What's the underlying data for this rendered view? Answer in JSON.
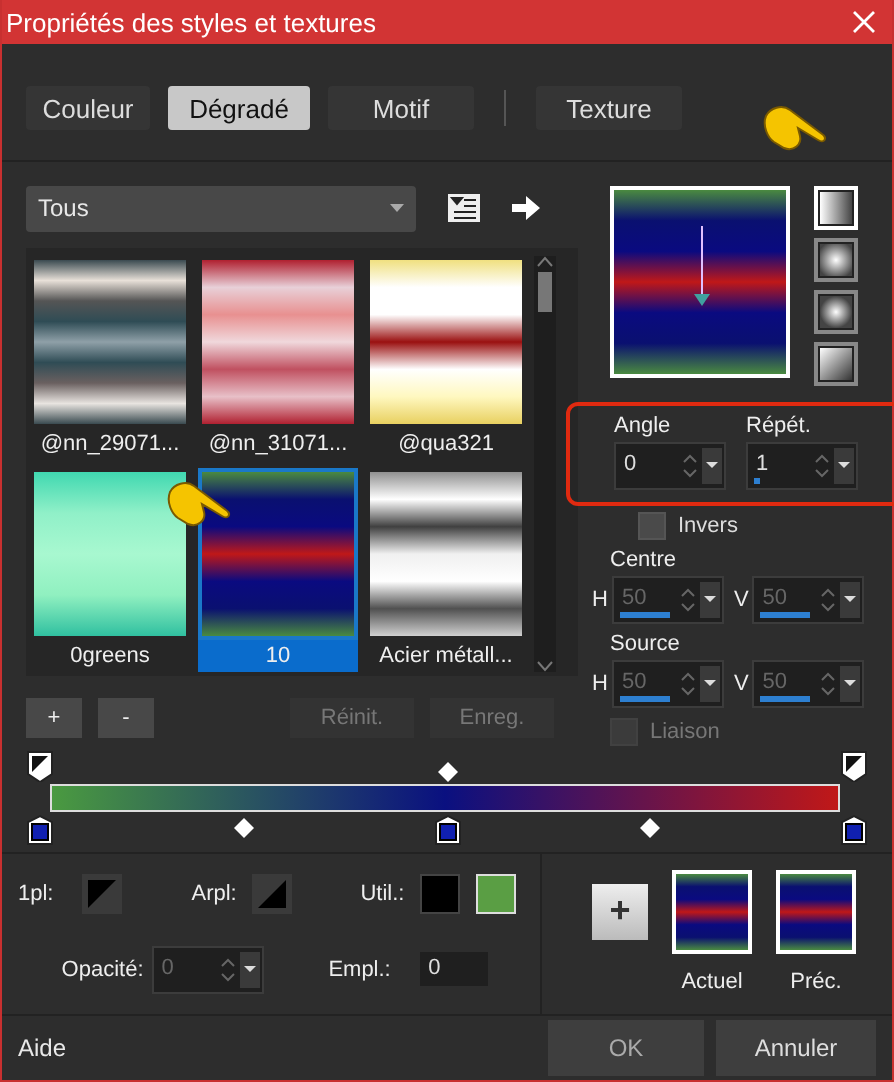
{
  "window": {
    "title": "Propriétés des styles et textures"
  },
  "tabs": [
    {
      "label": "Couleur",
      "selected": false
    },
    {
      "label": "Dégradé",
      "selected": true
    },
    {
      "label": "Motif",
      "selected": false
    },
    {
      "label": "Texture",
      "selected": false
    }
  ],
  "category": {
    "value": "Tous"
  },
  "presets": [
    {
      "name": "@nn_29071...",
      "selected": false
    },
    {
      "name": "@nn_31071...",
      "selected": false
    },
    {
      "name": "@qua321",
      "selected": false
    },
    {
      "name": "0greens",
      "selected": false
    },
    {
      "name": "10",
      "selected": true
    },
    {
      "name": "Acier métall...",
      "selected": false
    }
  ],
  "gradient_types": [
    {
      "kind": "linear",
      "selected": true
    },
    {
      "kind": "rectangular",
      "selected": false
    },
    {
      "kind": "radial",
      "selected": false
    },
    {
      "kind": "corner",
      "selected": false
    }
  ],
  "angle": {
    "label": "Angle",
    "value": "0"
  },
  "repeat": {
    "label": "Répét.",
    "value": "1",
    "level": 0.05
  },
  "invert": {
    "label": "Invers",
    "checked": false
  },
  "center": {
    "label": "Centre",
    "h": {
      "label": "H",
      "value": "50",
      "level": 0.5
    },
    "v": {
      "label": "V",
      "value": "50",
      "level": 0.5
    }
  },
  "source": {
    "label": "Source",
    "h": {
      "label": "H",
      "value": "50",
      "level": 0.5
    },
    "v": {
      "label": "V",
      "value": "50",
      "level": 0.5
    }
  },
  "link": {
    "label": "Liaison",
    "checked": false,
    "disabled": true
  },
  "list_buttons": [
    {
      "label": "+",
      "disabled": false
    },
    {
      "label": "-",
      "disabled": false
    },
    {
      "label": "Réinit.",
      "disabled": true
    },
    {
      "label": "Enreg.",
      "disabled": true
    }
  ],
  "stop_fields": {
    "first_label": "1pl:",
    "last_label": "Arpl:",
    "use_label": "Util.:",
    "use_colors": [
      {
        "color": "#000000",
        "selected": false
      },
      {
        "color": "#5a9e44",
        "selected": true
      }
    ],
    "opacity_label": "Opacité:",
    "opacity_value": "0",
    "location_label": "Empl.:",
    "location_value": "0"
  },
  "swatches": {
    "add_label": "+",
    "current_label": "Actuel",
    "previous_label": "Préc."
  },
  "footer": {
    "help": "Aide",
    "ok": "OK",
    "cancel": "Annuler"
  }
}
